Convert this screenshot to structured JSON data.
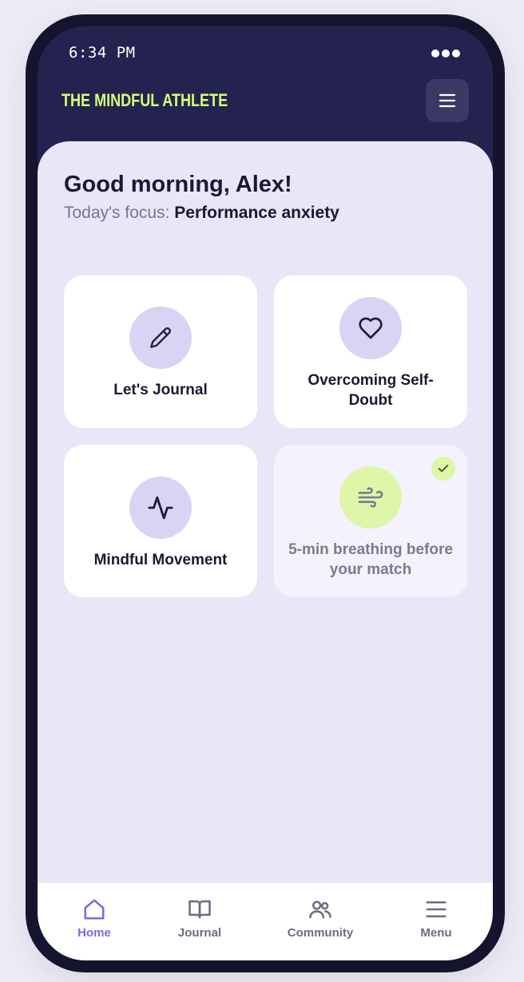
{
  "status_bar": {
    "time": "6:34 PM"
  },
  "header": {
    "brand": "THE MINDFUL ATHLETE",
    "menu_icon": "hamburger-icon"
  },
  "greeting": {
    "title": "Good morning, Alex!",
    "focus_prefix": "Today's focus:",
    "focus_topic": "Performance anxiety"
  },
  "cards": [
    {
      "label": "Let's Journal",
      "icon": "pencil-icon",
      "completed": false
    },
    {
      "label": "Overcoming Self-Doubt",
      "icon": "heart-icon",
      "completed": false
    },
    {
      "label": "Mindful Movement",
      "icon": "activity-pulse-icon",
      "completed": false
    },
    {
      "label": "5-min breathing before your match",
      "icon": "wind-icon",
      "completed": true
    }
  ],
  "bottom_nav": [
    {
      "label": "Home",
      "icon": "home-icon",
      "active": true
    },
    {
      "label": "Journal",
      "icon": "book-icon",
      "active": false
    },
    {
      "label": "Community",
      "icon": "users-icon",
      "active": false
    },
    {
      "label": "Menu",
      "icon": "menu-icon",
      "active": false
    }
  ],
  "colors": {
    "brand_accent": "#d6ff7a",
    "frame_dark": "#24234f",
    "content_bg": "#e9e6f8",
    "icon_circle": "#d9d3f4",
    "completed_green": "#dff5a7",
    "nav_active": "#8266e0"
  }
}
